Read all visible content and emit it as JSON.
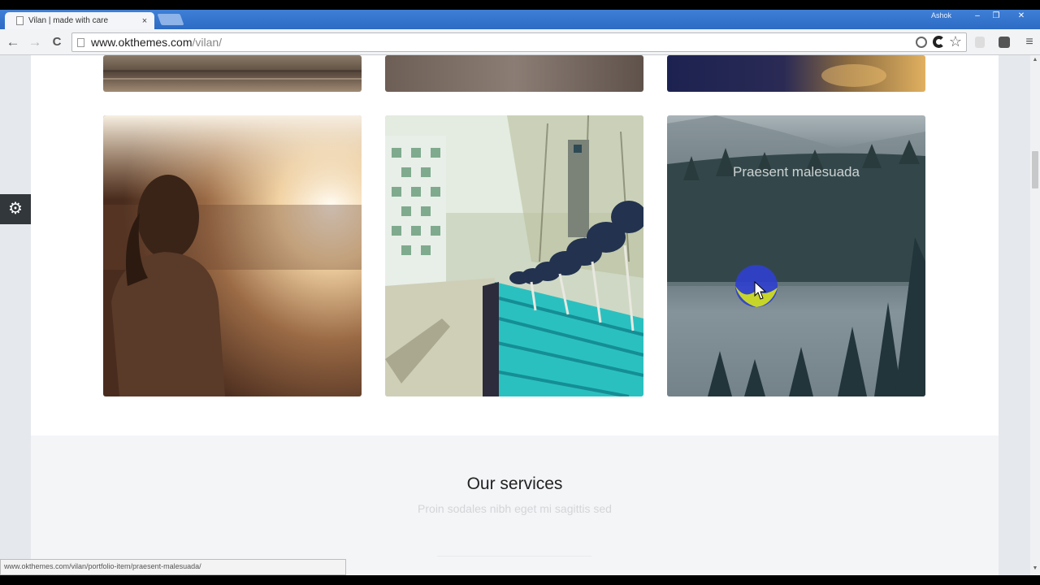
{
  "browser": {
    "tab_title": "Vilan | made with care",
    "tab_close": "×",
    "window_user": "Ashok",
    "win_min": "–",
    "win_restore": "❐",
    "win_close": "✕",
    "back_icon": "←",
    "forward_icon": "→",
    "reload_icon": "C",
    "url_host": "www.okthemes.com",
    "url_path": "/vilan/",
    "menu_icon": "≡",
    "star_icon": "☆",
    "status_url": "www.okthemes.com/vilan/portfolio-item/praesent-malesuada/"
  },
  "portfolio": {
    "items": [
      {
        "caption": "Praesent malesuada"
      }
    ]
  },
  "services": {
    "title": "Our services",
    "subtitle": "Proin sodales nibh eget mi sagittis sed"
  },
  "settings": {
    "icon": "⚙"
  },
  "scroll": {
    "up": "▲",
    "down": "▼"
  },
  "colors": {
    "tab_bar": "#2d6bc4",
    "settings_panel": "#32373c",
    "hover_overlay_blue": "#2f3fcf",
    "hover_overlay_yellow": "#c7d52a"
  }
}
